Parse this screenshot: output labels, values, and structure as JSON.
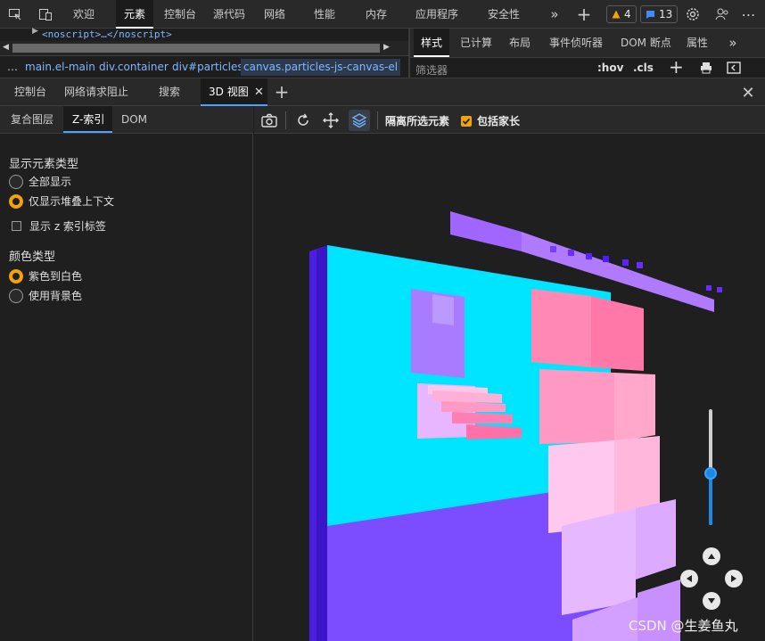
{
  "main_tabs": [
    {
      "label": "欢迎"
    },
    {
      "label": "元素"
    },
    {
      "label": "控制台"
    },
    {
      "label": "源代码"
    },
    {
      "label": "网络"
    },
    {
      "label": "性能"
    },
    {
      "label": "内存"
    },
    {
      "label": "应用程序"
    },
    {
      "label": "安全性"
    }
  ],
  "status": {
    "warnings": "4",
    "issues": "13"
  },
  "dom": {
    "snippet": "<noscript>…</noscript>"
  },
  "breadcrumbs": [
    "…",
    "main.el-main",
    "div.container",
    "div#particles",
    "canvas.particles-js-canvas-el"
  ],
  "styles_tabs": [
    {
      "label": "样式"
    },
    {
      "label": "已计算"
    },
    {
      "label": "布局"
    },
    {
      "label": "事件侦听器"
    },
    {
      "label": "DOM 断点"
    },
    {
      "label": "属性"
    }
  ],
  "filter": {
    "placeholder": "筛选器",
    "hov": ":hov",
    "cls": ".cls"
  },
  "drawer_tabs": [
    {
      "label": "控制台"
    },
    {
      "label": "网络请求阻止"
    },
    {
      "label": "搜索"
    },
    {
      "label": "3D 视图"
    }
  ],
  "view_subtabs": [
    {
      "label": "复合图层"
    },
    {
      "label": "Z-索引"
    },
    {
      "label": "DOM"
    }
  ],
  "settings": {
    "element_type_heading": "显示元素类型",
    "show_all": "全部显示",
    "stacking_only": "仅显示堆叠上下文",
    "show_z_labels": "显示 z 索引标签",
    "color_type_heading": "颜色类型",
    "purple_to_white": "紫色到白色",
    "background_color": "使用背景色"
  },
  "view_toolbar": {
    "isolate": "隔离所选元素",
    "include_parents": "包括家长"
  },
  "zoom_level": 0.45,
  "watermark": "CSDN @生姜鱼丸",
  "colors": {
    "accent": "#4aa3ff",
    "radio": "#f0a30a",
    "cyan": "#00e5ff",
    "violet": "#7c4dff"
  }
}
